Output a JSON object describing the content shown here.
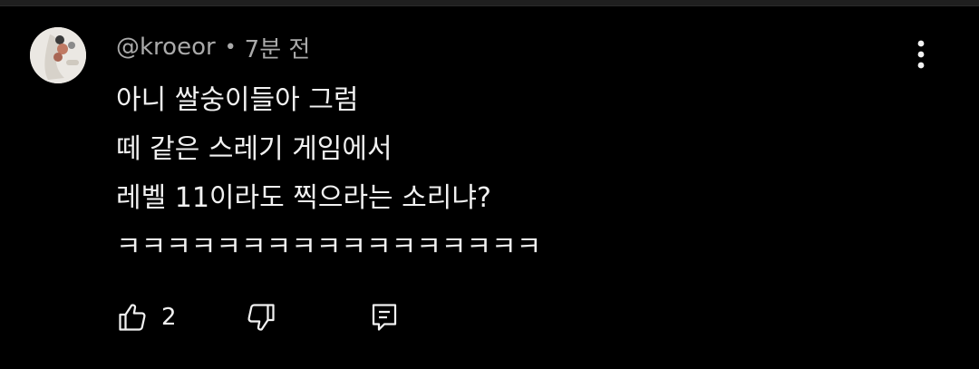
{
  "comment": {
    "author": "@kroeor",
    "separator": "•",
    "time": "7분 전",
    "lines": [
      "아니 쌀숭이들아 그럼",
      "떼 같은 스레기 게임에서",
      "레벨 11이라도 찍으라는 소리냐?",
      "ㅋㅋㅋㅋㅋㅋㅋㅋㅋㅋㅋㅋㅋㅋㅋㅋㅋ"
    ],
    "like_count": "2"
  },
  "icons": {
    "avatar": "avatar-image",
    "more": "more-vert-icon",
    "like": "thumbs-up-icon",
    "dislike": "thumbs-down-icon",
    "reply": "reply-comment-icon"
  },
  "colors": {
    "background": "#000000",
    "primary_text": "#f1f1f1",
    "secondary_text": "#aaaaaa"
  }
}
